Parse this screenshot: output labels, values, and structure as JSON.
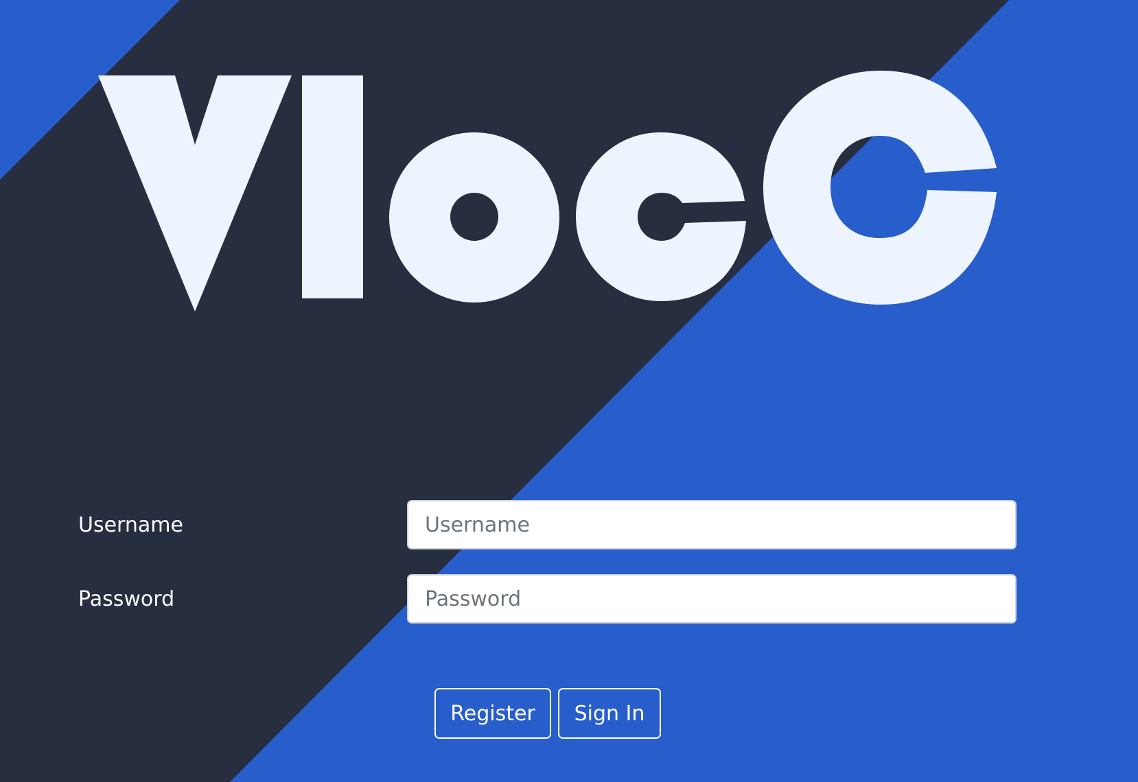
{
  "logo": {
    "text": "VlocC"
  },
  "colors": {
    "dark": "#272e3f",
    "blue": "#285ecb",
    "logo": "#edf4fd"
  },
  "form": {
    "username": {
      "label": "Username",
      "placeholder": "Username",
      "value": ""
    },
    "password": {
      "label": "Password",
      "placeholder": "Password",
      "value": ""
    }
  },
  "buttons": {
    "register": "Register",
    "sign_in": "Sign In"
  }
}
